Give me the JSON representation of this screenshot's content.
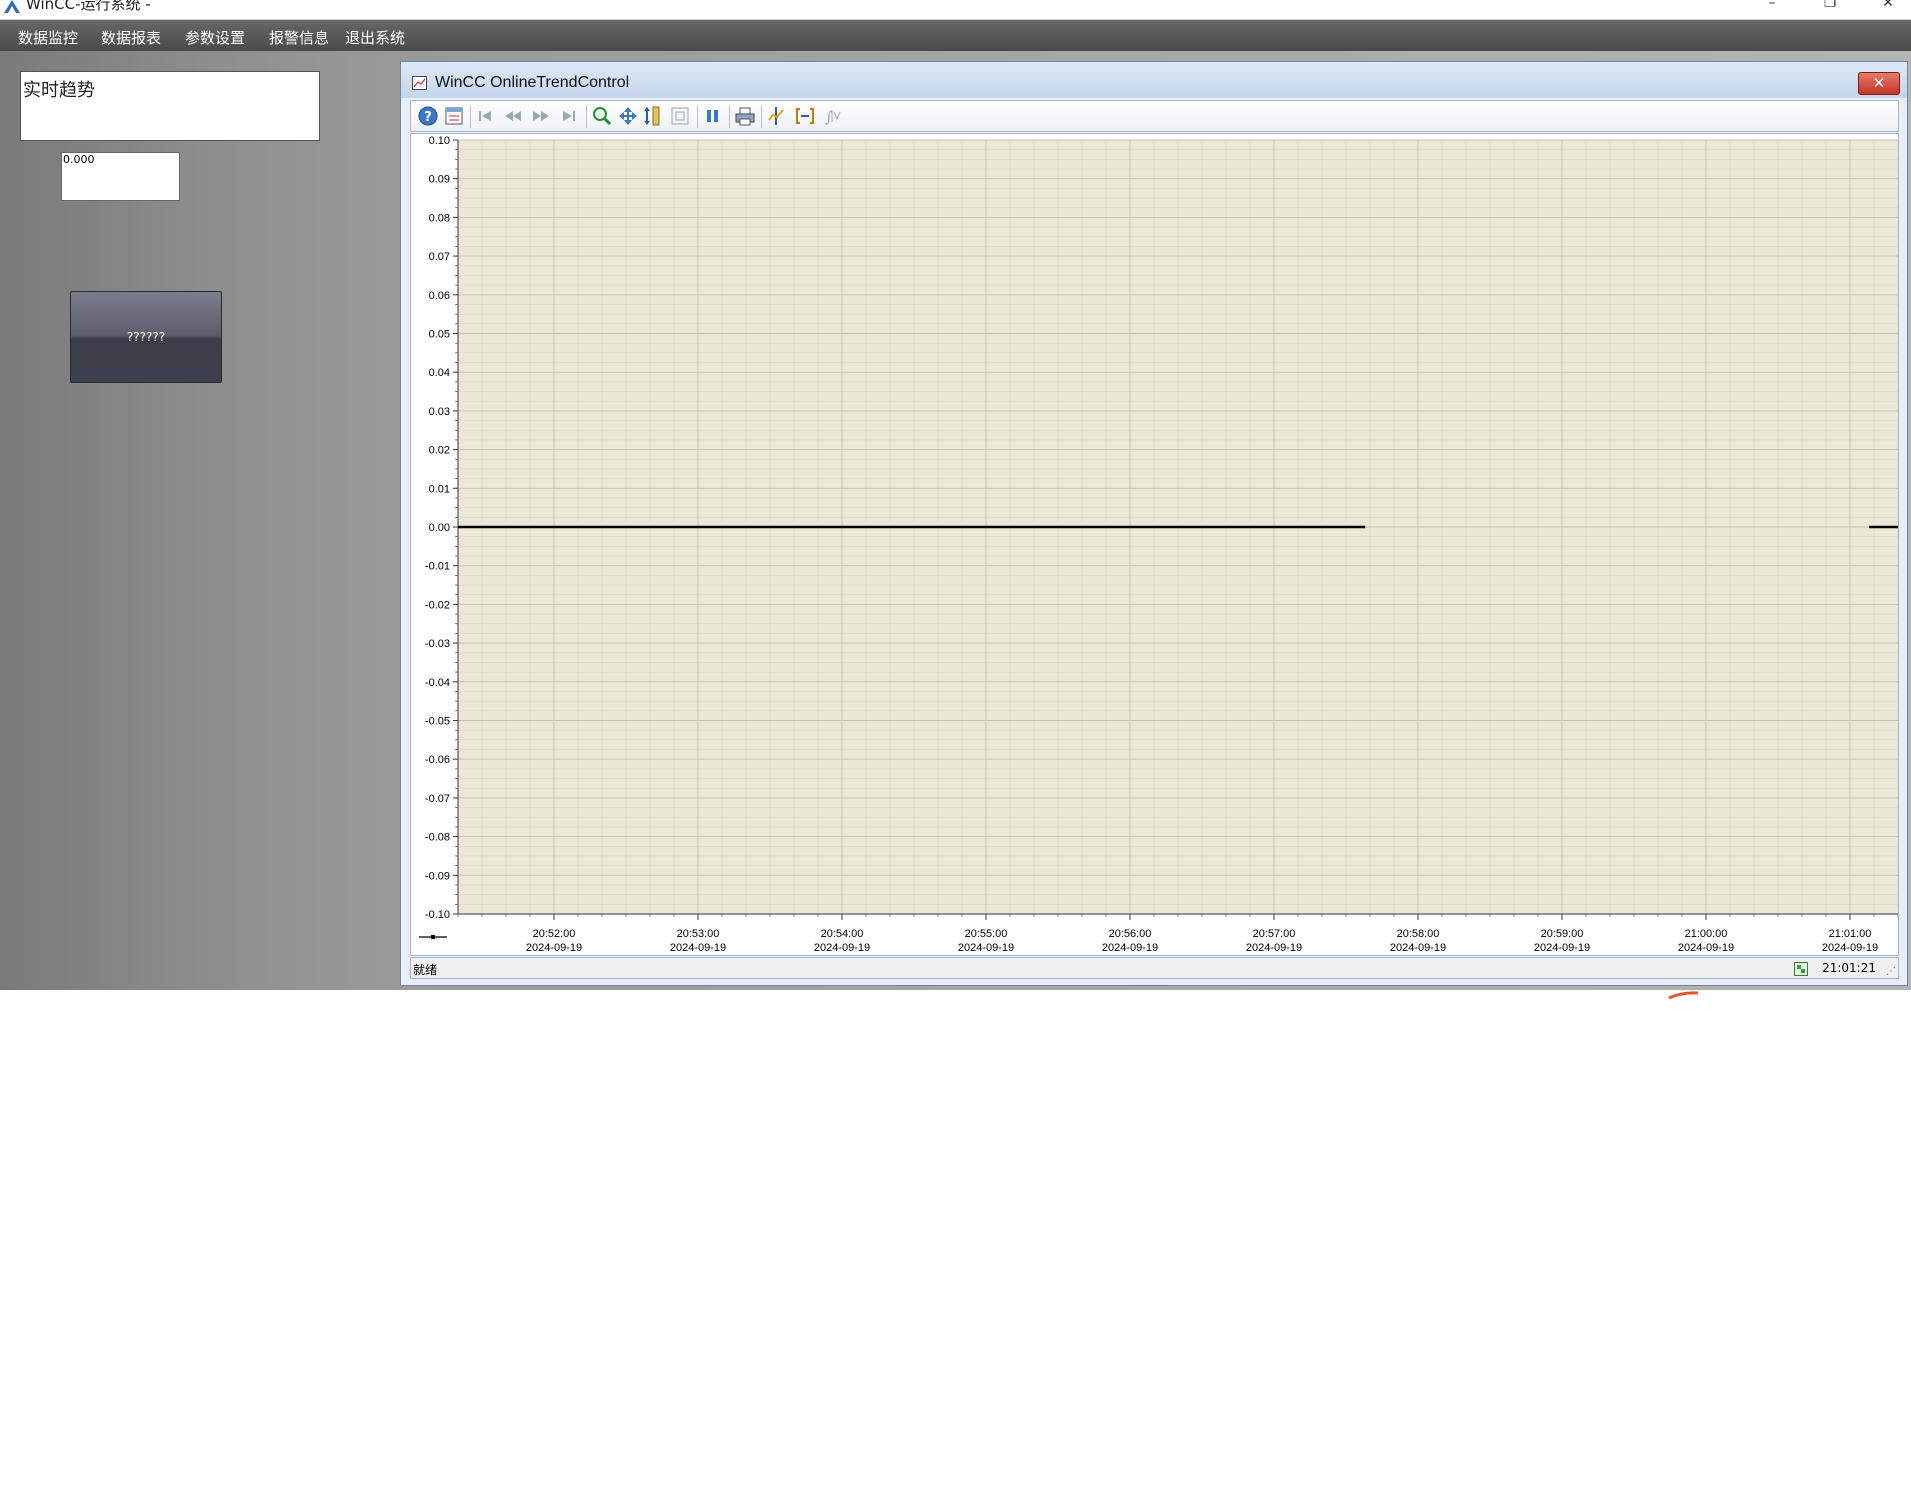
{
  "window": {
    "title": "WinCC-运行系统 -",
    "minimize": "–",
    "restore": "❐",
    "close": "✕"
  },
  "menu": {
    "items": [
      "数据监控",
      "数据报表",
      "参数设置",
      "报警信息",
      "退出系统"
    ]
  },
  "screen": {
    "trend_label": "实时趋势",
    "value_display": "0.000",
    "button_label": "??????"
  },
  "trend_control": {
    "title": "WinCC OnlineTrendControl",
    "close_icon": "close-icon",
    "toolbar": [
      "help-icon",
      "config-dialog-icon",
      "first-record-icon",
      "previous-record-icon",
      "next-record-icon",
      "last-record-icon",
      "zoom-area-icon",
      "move-curve-icon",
      "zoom-value-axis-icon",
      "original-view-icon",
      "start-stop-icon",
      "print-icon",
      "ruler-icon",
      "statistics-area-icon",
      "statistics-icon"
    ],
    "status": {
      "text": "就绪",
      "time": "21:01:21"
    }
  },
  "chart_data": {
    "type": "line",
    "background": "#ebe8d7",
    "grid": true,
    "value_axis": {
      "range": [
        -0.1,
        0.1
      ],
      "ticks": [
        "0.10",
        "0.09",
        "0.08",
        "0.07",
        "0.06",
        "0.05",
        "0.04",
        "0.03",
        "0.02",
        "0.01",
        "0.00",
        "-0.01",
        "-0.02",
        "-0.03",
        "-0.04",
        "-0.05",
        "-0.06",
        "-0.07",
        "-0.08",
        "-0.09",
        "-0.10"
      ]
    },
    "time_axis": {
      "range": [
        "20:51:20",
        "21:01:20"
      ],
      "ticks": [
        {
          "time": "20:52:00",
          "date": "2024-09-19"
        },
        {
          "time": "20:53:00",
          "date": "2024-09-19"
        },
        {
          "time": "20:54:00",
          "date": "2024-09-19"
        },
        {
          "time": "20:55:00",
          "date": "2024-09-19"
        },
        {
          "time": "20:56:00",
          "date": "2024-09-19"
        },
        {
          "time": "20:57:00",
          "date": "2024-09-19"
        },
        {
          "time": "20:58:00",
          "date": "2024-09-19"
        },
        {
          "time": "20:59:00",
          "date": "2024-09-19"
        },
        {
          "time": "21:00:00",
          "date": "2024-09-19"
        },
        {
          "time": "21:01:00",
          "date": "2024-09-19"
        }
      ]
    },
    "series": [
      {
        "color": "#000000",
        "segments": [
          {
            "from": "20:51:20",
            "to": "20:57:38",
            "value": 0.0
          },
          {
            "from": "21:01:08",
            "to": "21:01:20",
            "value": 0.0
          }
        ]
      }
    ]
  }
}
